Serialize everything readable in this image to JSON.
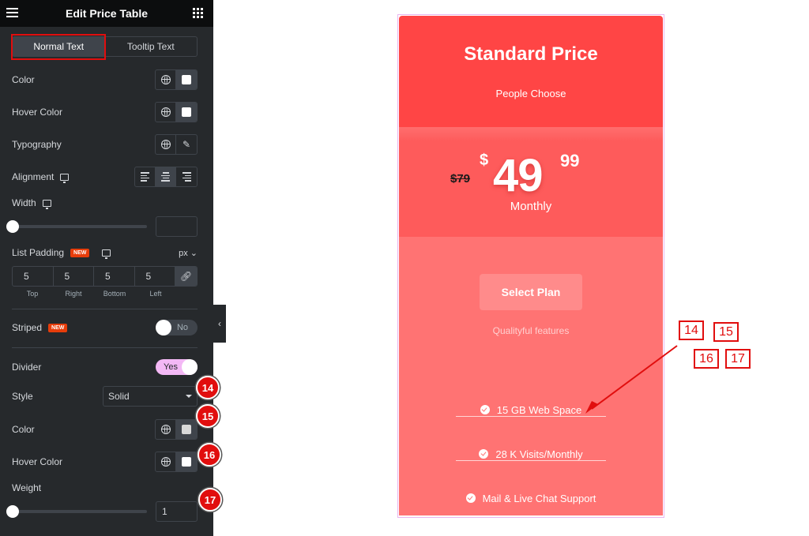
{
  "panel": {
    "title": "Edit Price Table",
    "menu_icon": "hamburger-icon",
    "apps_icon": "grid-icon",
    "tabs": [
      {
        "label": "Normal Text",
        "active": true
      },
      {
        "label": "Tooltip Text",
        "active": false
      }
    ],
    "color_label": "Color",
    "hover_color_label": "Hover Color",
    "typography_label": "Typography",
    "alignment_label": "Alignment",
    "alignment_value": "center",
    "width_label": "Width",
    "width_value": "",
    "list_padding_label": "List Padding",
    "new_badge": "NEW",
    "unit": "px",
    "padding": {
      "top": "5",
      "right": "5",
      "bottom": "5",
      "left": "5"
    },
    "padding_labels": {
      "top": "Top",
      "right": "Right",
      "bottom": "Bottom",
      "left": "Left"
    },
    "striped_label": "Striped",
    "striped_value": "No",
    "divider_label": "Divider",
    "divider_value": "Yes",
    "style_label": "Style",
    "style_value": "Solid",
    "divider_color_label": "Color",
    "divider_hover_color_label": "Hover Color",
    "weight_label": "Weight",
    "weight_value": "1",
    "collapse_icon": "‹"
  },
  "markers": [
    "14",
    "15",
    "16",
    "17"
  ],
  "card": {
    "title": "Standard Price",
    "subtitle": "People Choose",
    "old_price": "$79",
    "currency": "$",
    "amount": "49",
    "cents": "99",
    "period": "Monthly",
    "button": "Select Plan",
    "features_title": "Qualityful features",
    "features": [
      "15 GB Web Space",
      "28 K Visits/Monthly",
      "Mail & Live Chat Support"
    ],
    "colors": {
      "header": "#ff4545",
      "price": "#fe5b5b",
      "body": "#ff7373",
      "button": "#ff8b8b"
    }
  },
  "annotations": [
    "14",
    "15",
    "16",
    "17"
  ]
}
